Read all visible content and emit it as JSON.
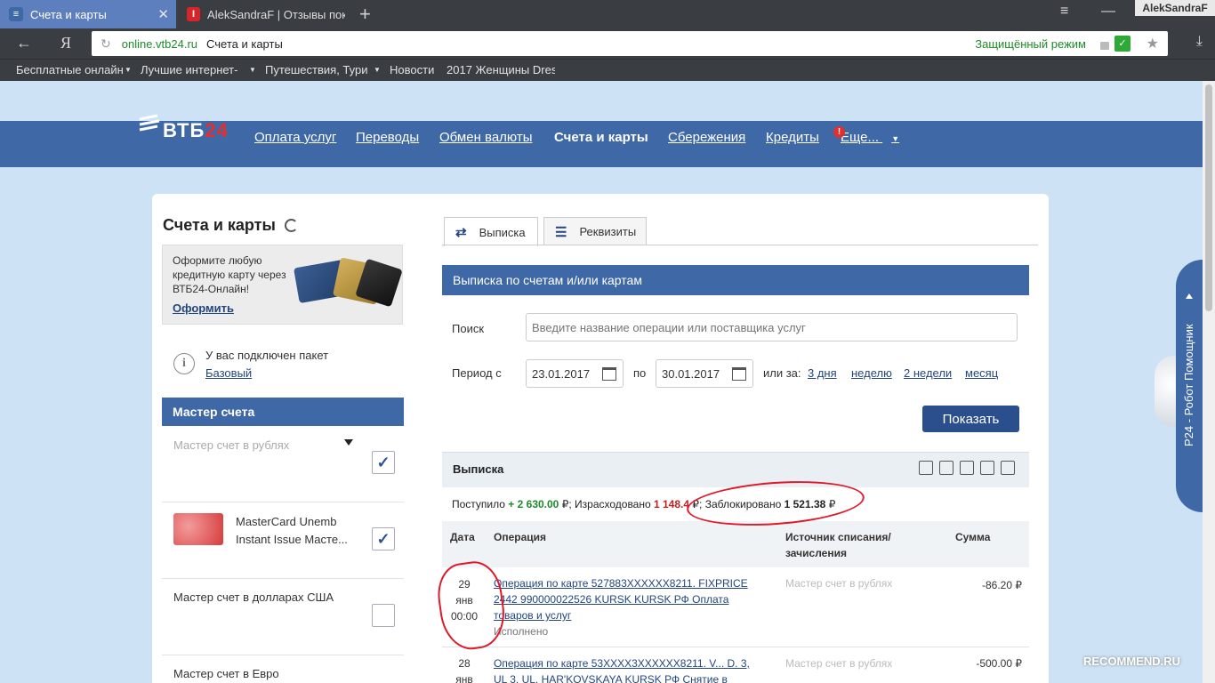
{
  "browser": {
    "tabs": [
      {
        "label": "Счета и карты"
      },
      {
        "label": "AlekSandraF | Отзывы покуп"
      }
    ],
    "user_badge": "AlekSandraF",
    "url_domain": "online.vtb24.ru",
    "url_title": "Счета и карты",
    "secure_label": "Защищённый режим",
    "bookmarks": [
      "Бесплатные онлайн",
      "Лучшие интернет-",
      "Путешествия, Тури",
      "Новости",
      "2017 Женщины Dres"
    ]
  },
  "site": {
    "logo": {
      "text": "ВТБ",
      "num": "24"
    },
    "nav": [
      {
        "label": "Оплата услуг"
      },
      {
        "label": "Переводы"
      },
      {
        "label": "Обмен валюты"
      },
      {
        "label": "Счета и карты"
      },
      {
        "label": "Сбережения"
      },
      {
        "label": "Кредиты"
      },
      {
        "label": "Еще...",
        "badge": "!"
      }
    ]
  },
  "left": {
    "title": "Счета и карты",
    "promo_text": "Оформите любую кредитную карту через ВТБ24-Онлайн!",
    "promo_link": "Оформить",
    "package_text": "У вас подключен пакет",
    "package_link": "Базовый",
    "master_title": "Мастер счета",
    "accounts": [
      {
        "name": "Мастер счет в рублях",
        "checked": true
      },
      {
        "name": "MasterCard Unemb",
        "name2": "Instant Issue Масте...",
        "checked": true
      },
      {
        "name": "Мастер счет в долларах США",
        "checked": false
      },
      {
        "name": "Мастер счет в Евро",
        "checked": false
      }
    ]
  },
  "right": {
    "tabs": [
      {
        "label": "Выписка",
        "icon": "⇄"
      },
      {
        "label": "Реквизиты",
        "icon": "☰"
      }
    ],
    "section_title": "Выписка по счетам и/или картам",
    "search_label": "Поиск",
    "search_placeholder": "Введите название операции или поставщика услуг",
    "period_label": "Период с",
    "date_from": "23.01.2017",
    "to_label": "по",
    "date_to": "30.01.2017",
    "or_label": "или за:",
    "quick": [
      "3 дня",
      "неделю",
      "2 недели",
      "месяц"
    ],
    "show_button": "Показать",
    "extract_title": "Выписка",
    "summary": {
      "in_label": "Поступило",
      "in_value": "+ 2 630.00",
      "out_label": "; Израсходовано",
      "out_value": "1 148.4",
      "blocked_label": "; Заблокировано",
      "blocked_value": "1 521.38",
      "currency": "₽"
    },
    "table": {
      "headers": [
        "Дата",
        "Операция",
        "Источник списания/ зачисления",
        "Сумма"
      ],
      "rows": [
        {
          "day": "29",
          "month": "янв",
          "time": "00:00",
          "op": "Операция по карте 527883XXXXXX8211. FIXPRICE 2442 990000022526 KURSK KURSK РФ Оплата товаров и услуг",
          "status": "Исполнено",
          "source": "Мастер счет в рублях",
          "amount": "-86.20 ₽"
        },
        {
          "day": "28",
          "month": "янв",
          "time": "",
          "op": "Операция по карте 53XXXX3XXXXXX8211. V... D. 3, UL 3. UL. HAR'KOVSKAYA KURSK РФ Снятие в банкомате",
          "status": "",
          "source": "Мастер счет в рублях",
          "amount": "-500.00 ₽"
        }
      ]
    }
  },
  "assistant": {
    "label": "Р24 - Робот Помощник"
  },
  "watermark": "RECOMMEND.RU",
  "colors": {
    "brand": "#3f68a6",
    "accent_red": "#e3302f",
    "green": "#1b8a2a",
    "annotation": "#e0182a"
  }
}
